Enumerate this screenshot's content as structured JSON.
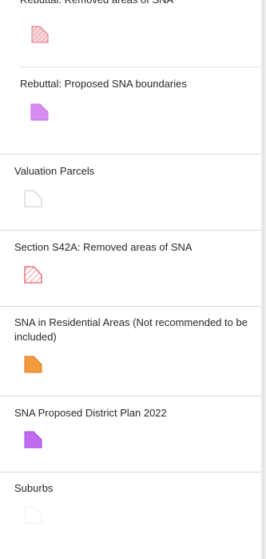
{
  "legend": {
    "groups": [
      {
        "title": "Rebuttal: Removed areas of SNA",
        "swatch": "hatched-pink"
      },
      {
        "title": "Rebuttal: Proposed SNA boundaries",
        "swatch": "solid-violet"
      },
      {
        "title": "Valuation Parcels",
        "swatch": "outline-gray"
      },
      {
        "title": "Section S42A: Removed areas of SNA",
        "swatch": "hatched-red"
      },
      {
        "title": "SNA in Residential Areas (Not recommended to be included)",
        "swatch": "solid-orange"
      },
      {
        "title": "SNA Proposed District Plan 2022",
        "swatch": "solid-purple"
      },
      {
        "title": "Suburbs",
        "swatch": "outline-faint"
      }
    ]
  },
  "colors": {
    "panel_bg": "#ffffff",
    "divider": "#d7d7d7",
    "hatched_pink": "#e9a1a7",
    "solid_violet": "#d88cf0",
    "outline_gray": "#c9c9c9",
    "hatched_red": "#e85d6a",
    "solid_orange": "#f39a3d",
    "solid_purple": "#c06bf0",
    "outline_faint": "#efefef"
  }
}
